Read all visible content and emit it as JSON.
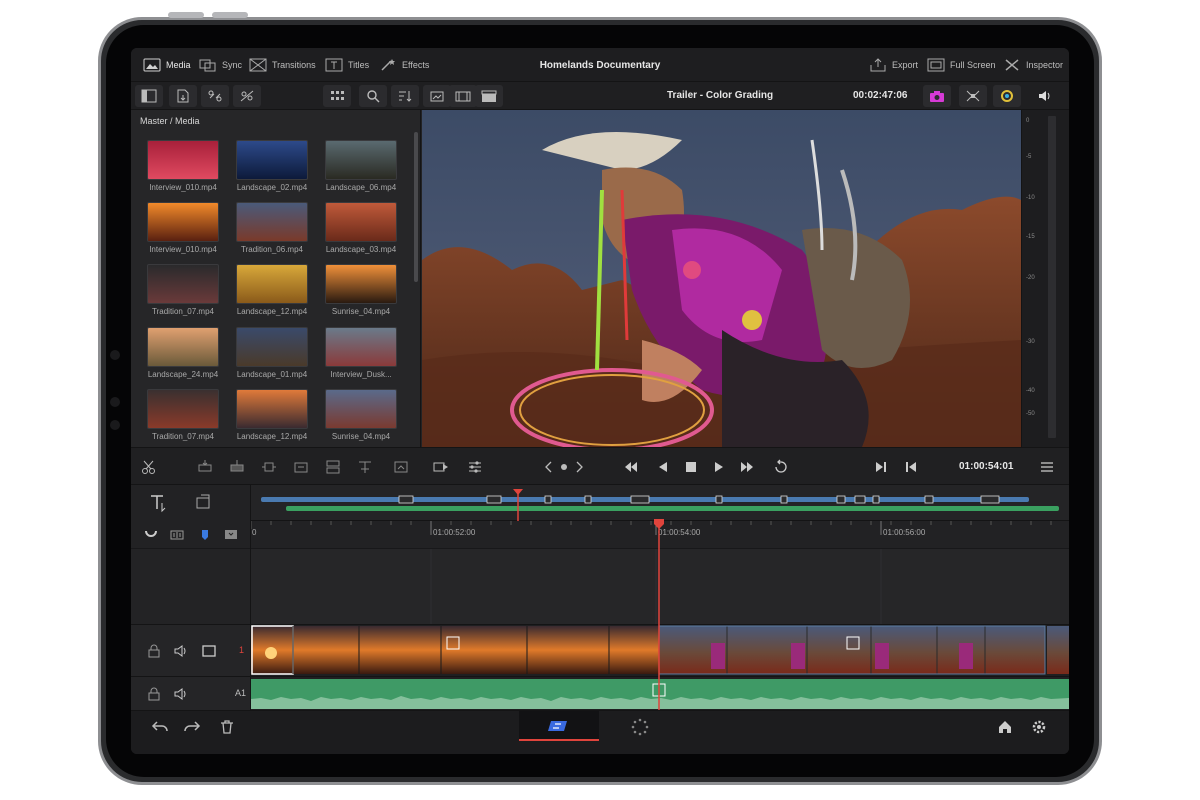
{
  "app": {
    "project_title": "Homelands Documentary",
    "timeline_name": "Trailer - Color Grading",
    "source_timecode": "00:02:47:06",
    "record_timecode": "01:00:54:01"
  },
  "topbar": {
    "left_nav": [
      {
        "label": "Media",
        "icon": "media-icon",
        "active": true
      },
      {
        "label": "Sync",
        "icon": "sync-icon",
        "active": false
      },
      {
        "label": "Transitions",
        "icon": "transitions-icon",
        "active": false
      },
      {
        "label": "Titles",
        "icon": "titles-icon",
        "active": false
      },
      {
        "label": "Effects",
        "icon": "effects-icon",
        "active": false
      }
    ],
    "right_nav": [
      {
        "label": "Export",
        "icon": "export-icon"
      },
      {
        "label": "Full Screen",
        "icon": "fullscreen-icon"
      },
      {
        "label": "Inspector",
        "icon": "inspector-icon"
      }
    ]
  },
  "media_pool": {
    "breadcrumb": "Master / Media",
    "clips": [
      {
        "name": "Interview_010.mp4",
        "colors": [
          "#a8203a",
          "#e04a60"
        ]
      },
      {
        "name": "Landscape_02.mp4",
        "colors": [
          "#2d4a8a",
          "#0d1a3a"
        ]
      },
      {
        "name": "Landscape_06.mp4",
        "colors": [
          "#5a6a70",
          "#2a2a22"
        ]
      },
      {
        "name": "Interview_010.mp4",
        "colors": [
          "#f28a2a",
          "#5a2010"
        ]
      },
      {
        "name": "Tradition_06.mp4",
        "colors": [
          "#4a5a7a",
          "#7a3a2a"
        ]
      },
      {
        "name": "Landscape_03.mp4",
        "colors": [
          "#c05a3a",
          "#6a2a1a"
        ]
      },
      {
        "name": "Tradition_07.mp4",
        "colors": [
          "#2a2a2c",
          "#6a3a3a"
        ]
      },
      {
        "name": "Landscape_12.mp4",
        "colors": [
          "#d8a83a",
          "#8a5a1a"
        ]
      },
      {
        "name": "Sunrise_04.mp4",
        "colors": [
          "#f0903a",
          "#2a1a10"
        ]
      },
      {
        "name": "Landscape_24.mp4",
        "colors": [
          "#e0a070",
          "#6a5a3a"
        ]
      },
      {
        "name": "Landscape_01.mp4",
        "colors": [
          "#3a4a6a",
          "#4a3a2a"
        ]
      },
      {
        "name": "Interview_Dusk...",
        "colors": [
          "#6a7a8a",
          "#8a3a3a"
        ]
      },
      {
        "name": "Tradition_07.mp4",
        "colors": [
          "#3a3030",
          "#8a3a2a"
        ]
      },
      {
        "name": "Landscape_12.mp4",
        "colors": [
          "#e07a3a",
          "#3a2a30"
        ]
      },
      {
        "name": "Sunrise_04.mp4",
        "colors": [
          "#5a6a8a",
          "#7a3a30"
        ]
      }
    ]
  },
  "meters": {
    "scale": [
      "0",
      "-5",
      "-10",
      "-15",
      "-20",
      "-30",
      "-40",
      "-50"
    ]
  },
  "ruler": {
    "labels": [
      "0",
      "01:00:52:00",
      "01:00:54:00",
      "01:00:56:00"
    ]
  },
  "tracks": {
    "video_label": "1",
    "audio_label": "A1"
  },
  "colors": {
    "accent_red": "#e0443c",
    "clip_blue": "#4a6a9a",
    "audio_green": "#4a9a6a",
    "playhead": "#e0443c"
  }
}
